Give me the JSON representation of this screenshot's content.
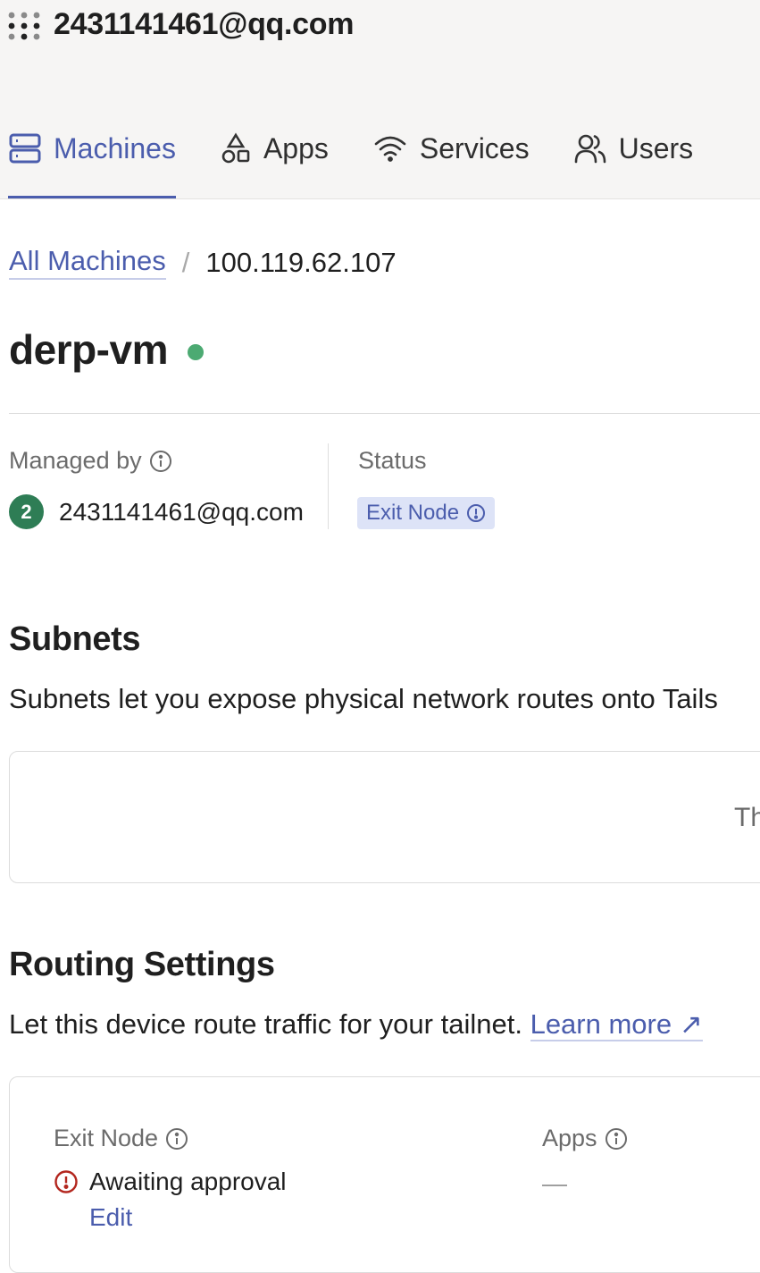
{
  "header": {
    "account_email": "2431141461@qq.com",
    "tabs": [
      {
        "label": "Machines",
        "icon": "server-icon",
        "active": true
      },
      {
        "label": "Apps",
        "icon": "apps-shapes-icon",
        "active": false
      },
      {
        "label": "Services",
        "icon": "wifi-icon",
        "active": false
      },
      {
        "label": "Users",
        "icon": "users-icon",
        "active": false
      }
    ]
  },
  "breadcrumb": {
    "parent": "All Machines",
    "separator": "/",
    "current": "100.119.62.107"
  },
  "machine": {
    "name": "derp-vm",
    "online_color": "#4caa72",
    "managed_by_label": "Managed by",
    "owner_initial": "2",
    "owner_email": "2431141461@qq.com",
    "status_label": "Status",
    "status_badge": "Exit Node"
  },
  "subnets": {
    "title": "Subnets",
    "description": "Subnets let you expose physical network routes onto Tails",
    "card_text": "Th"
  },
  "routing": {
    "title": "Routing Settings",
    "description": "Let this device route traffic for your tailnet.",
    "learn_more": "Learn more ↗",
    "exit_node_label": "Exit Node",
    "exit_node_status": "Awaiting approval",
    "edit_label": "Edit",
    "apps_label": "Apps",
    "apps_value": "—"
  },
  "colors": {
    "accent": "#4b5dad",
    "warning": "#b3261e",
    "avatar": "#2e7d55"
  }
}
